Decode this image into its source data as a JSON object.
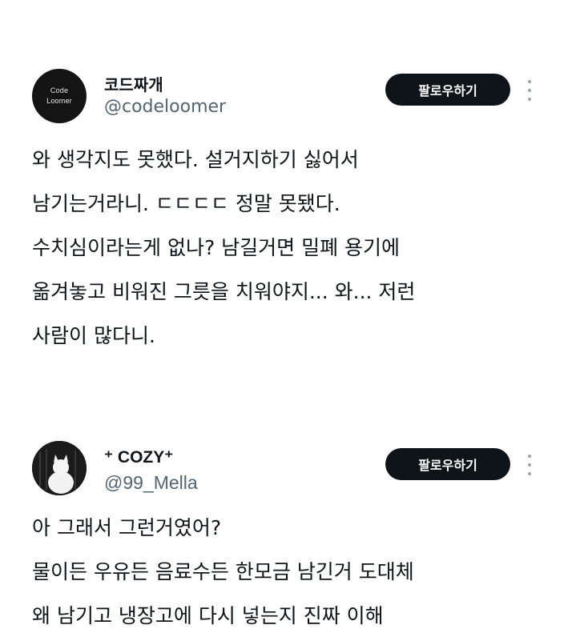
{
  "posts": [
    {
      "display_name": "코드짜개",
      "handle": "@codeloomer",
      "avatar_logo_text": "Code\nLoomer",
      "follow_label": "팔로우하기",
      "body": "와 생각지도 못했다. 설거지하기 싫어서\n남기는거라니. ㄷㄷㄷㄷ 정말 못됐다.\n수치심이라는게 없나? 남길거면 밀폐 용기에\n옮겨놓고 비워진 그릇을 치워야지... 와... 저런\n사람이 많다니."
    },
    {
      "display_name": "⁺ COZY⁺",
      "handle": "@99_Mella",
      "follow_label": "팔로우하기",
      "body": "아 그래서 그런거였어?\n물이든 우유든 음료수든 한모금 남긴거 도대체\n왜 남기고 냉장고에 다시 넣는지 진짜 이해"
    }
  ],
  "icons": {
    "more": "more-vertical-icon",
    "avatar2": "white-cat-avatar"
  },
  "colors": {
    "text_primary": "#0f1419",
    "text_secondary": "#536471",
    "button_bg": "#0f1419",
    "button_text": "#ffffff"
  }
}
